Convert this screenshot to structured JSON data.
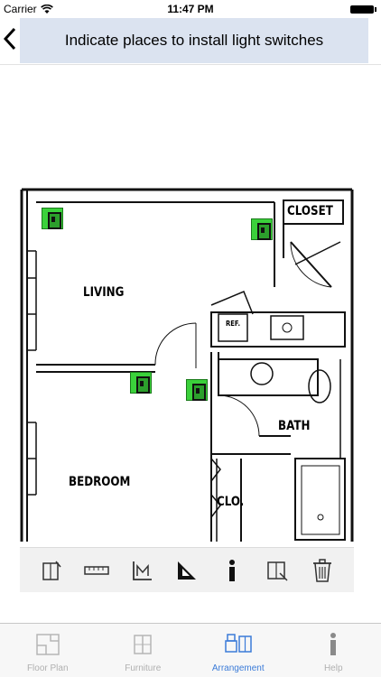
{
  "status_bar": {
    "carrier": "Carrier",
    "time": "11:47 PM"
  },
  "nav": {
    "title": "Indicate places to install light switches"
  },
  "floor_plan": {
    "rooms": {
      "closet": "CLOSET",
      "living": "LIVING",
      "ref": "REF.",
      "bath": "BATH",
      "bedroom": "BEDROOM",
      "clo": "CLO."
    }
  },
  "tabs": [
    {
      "label": "Floor Plan"
    },
    {
      "label": "Furniture"
    },
    {
      "label": "Arrangement"
    },
    {
      "label": "Help"
    }
  ],
  "colors": {
    "switch_marker": "#3bd13b",
    "active_tab": "#3b7bd8",
    "title_banner": "#dbe3f0"
  },
  "tools": [
    "add-door-icon",
    "ruler-icon",
    "measure-angle-icon",
    "set-square-icon",
    "info-icon",
    "resize-icon",
    "trash-icon"
  ]
}
